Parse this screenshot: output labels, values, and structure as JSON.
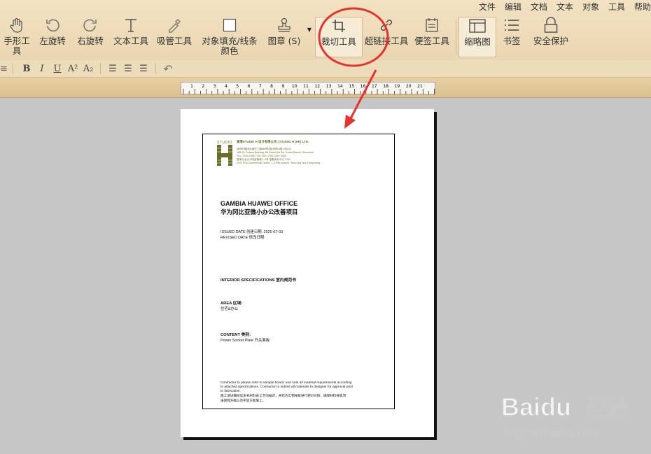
{
  "menubar": [
    "文件",
    "编辑",
    "文档",
    "文本",
    "对象",
    "工具",
    "帮助"
  ],
  "toolbar": {
    "tools": [
      {
        "label": "手形工具",
        "icon": "hand-icon",
        "w": 48
      },
      {
        "label": "左旋转",
        "icon": "rotate-left-icon",
        "w": 54
      },
      {
        "label": "右旋转",
        "icon": "rotate-right-icon",
        "w": 54
      },
      {
        "label": "文本工具",
        "icon": "text-tool-icon",
        "w": 62
      },
      {
        "label": "吸管工具",
        "icon": "eyedropper-icon",
        "w": 62
      },
      {
        "label": "对象填充/线条颜色",
        "icon": "fill-color-icon",
        "w": 96
      },
      {
        "label": "图章 (S)",
        "icon": "stamp-icon",
        "w": 60
      },
      {
        "label": "裁切工具",
        "icon": "crop-icon",
        "w": 70
      },
      {
        "label": "超链接工具",
        "icon": "hyperlink-icon",
        "w": 68
      },
      {
        "label": "便签工具",
        "icon": "note-icon",
        "w": 62
      },
      {
        "label": "缩略图",
        "icon": "thumbnail-icon",
        "w": 56
      },
      {
        "label": "书签",
        "icon": "bookmark-icon",
        "w": 44
      },
      {
        "label": "安全保护",
        "icon": "lock-icon",
        "w": 68
      }
    ],
    "format_buttons": [
      "B",
      "I",
      "U",
      "A²",
      "A₂"
    ]
  },
  "ruler": {
    "ticks": [
      "1",
      "2",
      "3",
      "4",
      "5",
      "6",
      "7",
      "8",
      "9",
      "10",
      "11",
      "12",
      "13",
      "14",
      "15",
      "16",
      "17",
      "18",
      "19",
      "20",
      "21"
    ]
  },
  "document": {
    "company_cn": "香港STUDIO H 设计有限公司 | STUDIO H (HK) LTD.",
    "addr1": "深圳市福田区福华三路88号财富大厦18楼 18B-03",
    "addr2": "18B-03 Fortune Building, 88 Fuhua 3rd Rd, Futian District, Shenzhen",
    "tel": "TEL: 0755 2399 7751   FAX: 0755 2399 7528",
    "addr3": "香港九龙尖沙咀宝勒巷 1-3号 宝勒商业中心 2102",
    "addr4": "2102 Prat Commercial Centre, 1-3 Prat Avenue, Tsim Sha Tsui, Hong Kong",
    "logo_text": "STUDIO",
    "title_en": "GAMBIA HUAWEI OFFICE",
    "title_cn": "华为冈比亚微小办公改善项目",
    "issued": "ISSUED DATE 创建日期: 2020-07-03",
    "revised": "REVISED DATE 修改日期:",
    "spec": "INTERIOR SPECIFICATIONS 室内规范书",
    "area_label": "AREA 区域:",
    "area_value": "住宅&办公",
    "content_label": "CONTENT 类别:",
    "content_value": "Power Socket Plate 开关面板",
    "note_en1": "Contractor to please refer to sample board, and note all material requirements according",
    "note_en2": "to attached specifications.  Contractor to submit all materials to designer for approval prior",
    "note_en3": "to fabrication.",
    "note_cn1": "施工请详细阅读本书材料表工艺的描述，并结合实物样板进行相对对照，确保材料样板须",
    "note_cn2": "送回我方确认签字后方能施工。"
  },
  "watermark": {
    "brand": "Baidu",
    "brand_cn": "经验",
    "url": "jingyan.baidu.com"
  },
  "colors": {
    "toolbar_bg": "#eedcb9",
    "canvas_bg": "#c6c6c6",
    "annotation": "#e8312b",
    "doc_logo": "#6b6b2a"
  }
}
